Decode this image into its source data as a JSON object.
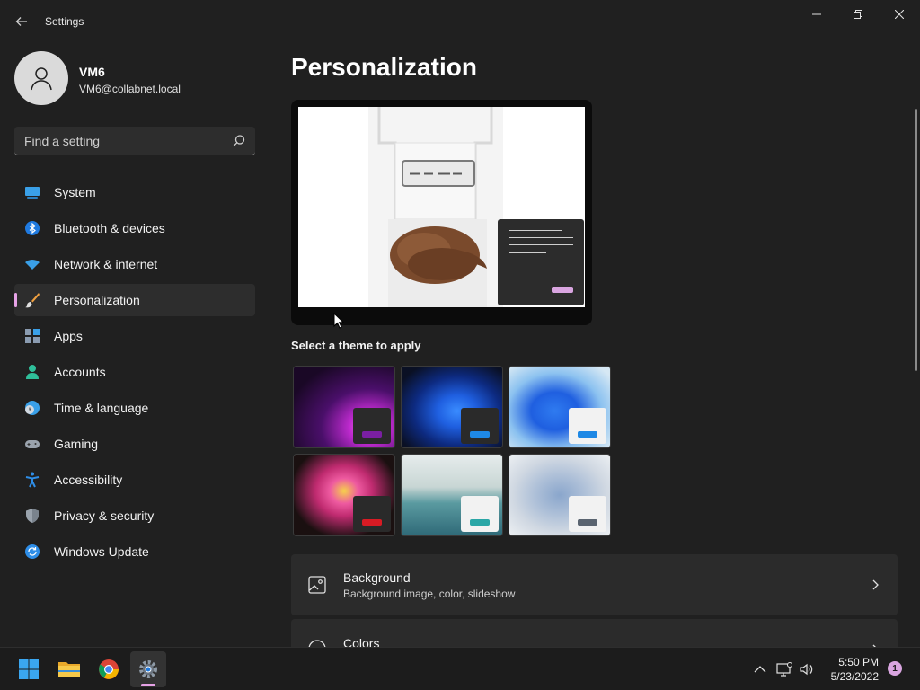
{
  "window": {
    "title": "Settings",
    "controls": {
      "minimize": "minimize-icon",
      "maximize": "restore-icon",
      "close": "close-icon"
    }
  },
  "profile": {
    "name": "VM6",
    "email": "VM6@collabnet.local"
  },
  "search": {
    "placeholder": "Find a setting",
    "value": ""
  },
  "sidebar": {
    "items": [
      {
        "label": "System",
        "icon": "system-icon",
        "active": false
      },
      {
        "label": "Bluetooth & devices",
        "icon": "bluetooth-icon",
        "active": false
      },
      {
        "label": "Network & internet",
        "icon": "wifi-icon",
        "active": false
      },
      {
        "label": "Personalization",
        "icon": "brush-icon",
        "active": true
      },
      {
        "label": "Apps",
        "icon": "apps-icon",
        "active": false
      },
      {
        "label": "Accounts",
        "icon": "accounts-icon",
        "active": false
      },
      {
        "label": "Time & language",
        "icon": "clock-globe-icon",
        "active": false
      },
      {
        "label": "Gaming",
        "icon": "gamepad-icon",
        "active": false
      },
      {
        "label": "Accessibility",
        "icon": "accessibility-icon",
        "active": false
      },
      {
        "label": "Privacy & security",
        "icon": "shield-icon",
        "active": false
      },
      {
        "label": "Windows Update",
        "icon": "update-icon",
        "active": false
      }
    ]
  },
  "main": {
    "title": "Personalization",
    "theme_heading": "Select a theme to apply",
    "themes": [
      {
        "name": "theme-glow",
        "accent": "#7a1fa2"
      },
      {
        "name": "theme-bloom-dark",
        "accent": "#1e88e5"
      },
      {
        "name": "theme-bloom-light",
        "accent": "#1e88e5"
      },
      {
        "name": "theme-captured-motion",
        "accent": "#d81b24"
      },
      {
        "name": "theme-sunrise",
        "accent": "#2aa6a6"
      },
      {
        "name": "theme-flow",
        "accent": "#5a6470"
      }
    ],
    "cards": [
      {
        "title": "Background",
        "subtitle": "Background image, color, slideshow",
        "icon": "image-icon"
      },
      {
        "title": "Colors",
        "subtitle": "",
        "icon": "palette-icon"
      }
    ]
  },
  "taskbar": {
    "apps": [
      "start-icon",
      "file-explorer-icon",
      "chrome-icon",
      "settings-icon"
    ],
    "clock": {
      "time": "5:50 PM",
      "date": "5/23/2022"
    },
    "notification_count": "1"
  },
  "colors": {
    "background": "#202020",
    "accent": "#e6a2e6"
  }
}
